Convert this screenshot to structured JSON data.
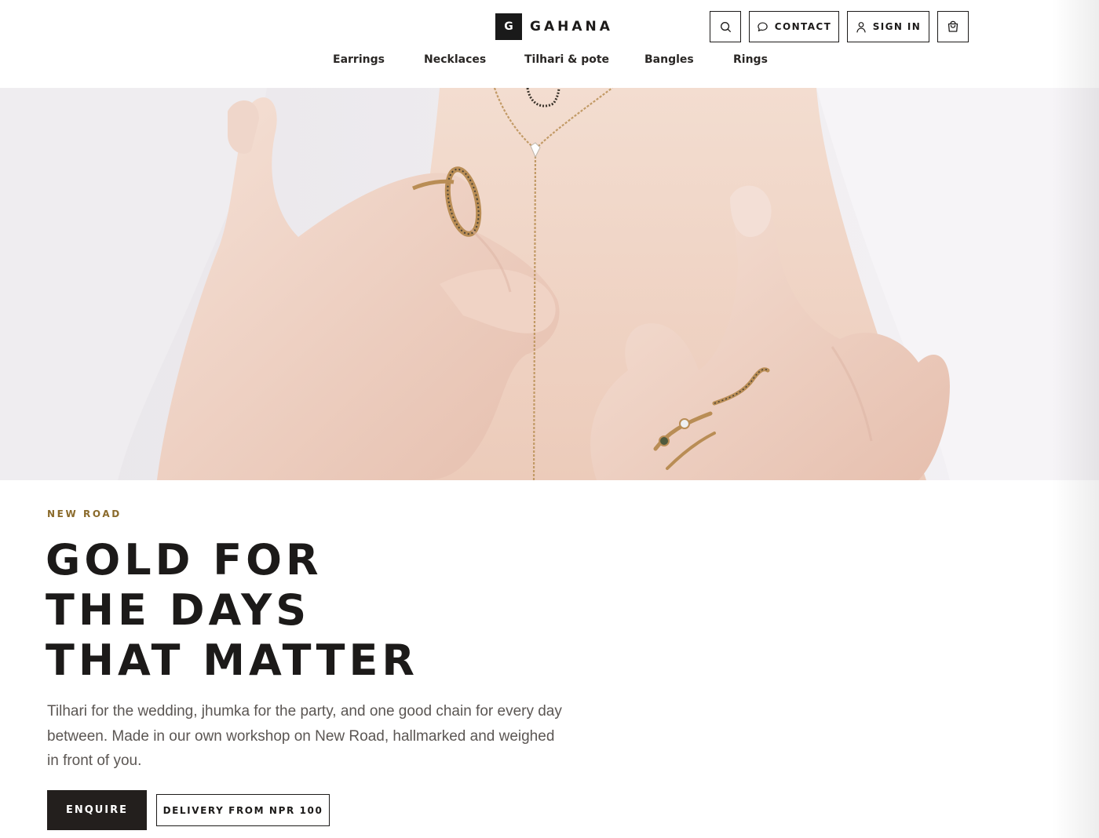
{
  "brand": {
    "mark": "G",
    "name": "GAHANA"
  },
  "header": {
    "search_icon": "search-icon",
    "contact_label": "CONTACT",
    "contact_icon": "chat-bubble-icon",
    "signin_label": "SIGN IN",
    "signin_icon": "user-icon",
    "cart_icon": "shopping-bag-icon"
  },
  "nav": {
    "items": [
      {
        "label": "Earrings"
      },
      {
        "label": "Necklaces"
      },
      {
        "label": "Tilhari & pote"
      },
      {
        "label": "Bangles"
      },
      {
        "label": "Rings"
      }
    ]
  },
  "hero": {
    "eyebrow": "NEW ROAD",
    "headline_lines": [
      "GOLD FOR",
      "THE DAYS",
      "THAT MATTER"
    ],
    "description": "Tilhari for the wedding, jhumka for the party, and one good chain for every day between. Made in our own workshop on New Road, hallmarked and weighed in front of you.",
    "primary_cta": "ENQUIRE",
    "secondary_cta": "DELIVERY FROM NPR 100"
  },
  "colors": {
    "ink": "#1c1a19",
    "accent_gold": "#8a6a2b",
    "button_dark": "#231f1d",
    "body_text": "#5b5653"
  }
}
